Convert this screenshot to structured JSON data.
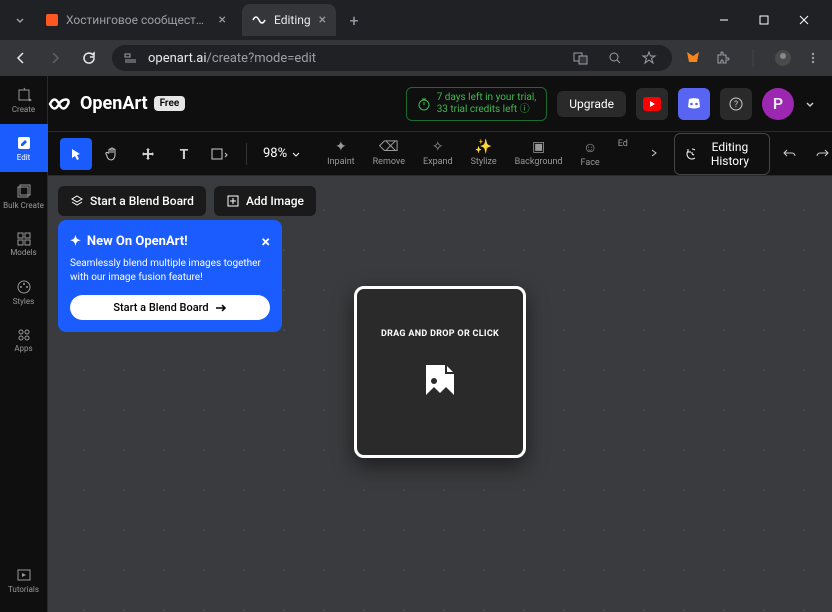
{
  "browser": {
    "tabs": [
      {
        "title": "Хостинговое сообщество «Tim"
      },
      {
        "title": "Editing"
      }
    ],
    "url_host": "openart.ai",
    "url_path": "/create?mode=edit"
  },
  "header": {
    "brand": "OpenArt",
    "badge": "Free",
    "trial_line1": "7 days left in your trial,",
    "trial_line2": "33 trial credits left",
    "upgrade": "Upgrade",
    "avatar_initial": "P"
  },
  "toolbar": {
    "zoom": "98%",
    "actions": [
      {
        "label": "Inpaint"
      },
      {
        "label": "Remove"
      },
      {
        "label": "Expand"
      },
      {
        "label": "Stylize"
      },
      {
        "label": "Background"
      },
      {
        "label": "Face"
      },
      {
        "label": "Ed"
      }
    ],
    "history": "Editing History"
  },
  "sidebar": {
    "items": [
      {
        "label": "Create"
      },
      {
        "label": "Edit"
      },
      {
        "label": "Bulk Create"
      },
      {
        "label": "Models"
      },
      {
        "label": "Styles"
      },
      {
        "label": "Apps"
      }
    ],
    "bottom": {
      "label": "Tutorials"
    }
  },
  "canvas": {
    "blend_board_btn": "Start a Blend Board",
    "add_image_btn": "Add Image",
    "dropzone_text": "DRAG AND DROP OR CLICK"
  },
  "onboard": {
    "title": "New On OpenArt!",
    "body": "Seamlessly blend multiple images together with our image fusion feature!",
    "cta": "Start a Blend Board"
  }
}
